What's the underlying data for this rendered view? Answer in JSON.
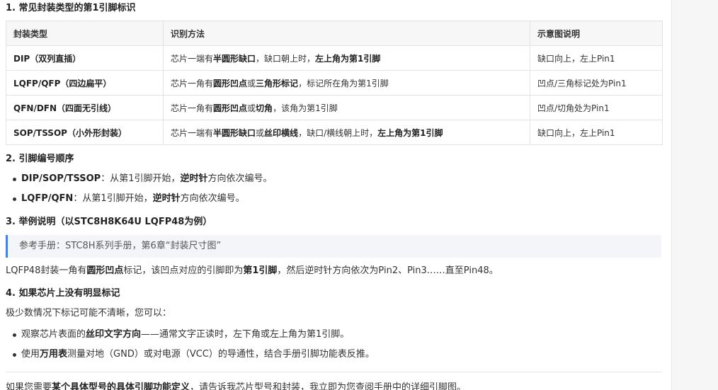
{
  "sec1": {
    "title": "1. 常见封装类型的第1引脚标识"
  },
  "table": {
    "headers": [
      "封装类型",
      "识别方法",
      "示意图说明"
    ],
    "rows": [
      {
        "type": "DIP（双列直插）",
        "m1": "芯片一端有",
        "m2": "半圆形缺口",
        "m3": "，缺口朝上时，",
        "m4": "左上角为第1引脚",
        "m5": "",
        "m6": "",
        "m7": "",
        "hint": "缺口向上，左上Pin1"
      },
      {
        "type": "LQFP/QFP（四边扁平）",
        "m1": "芯片一角有",
        "m2": "圆形凹点",
        "m3": "或",
        "m4": "三角形标记",
        "m5": "，标记所在角为第1引脚",
        "m6": "",
        "m7": "",
        "hint": "凹点/三角标记处为Pin1"
      },
      {
        "type": "QFN/DFN（四面无引线）",
        "m1": "芯片一角有",
        "m2": "圆形凹点",
        "m3": "或",
        "m4": "切角",
        "m5": "，该角为第1引脚",
        "m6": "",
        "m7": "",
        "hint": "凹点/切角处为Pin1"
      },
      {
        "type": "SOP/TSSOP（小外形封装）",
        "m1": "芯片一端有",
        "m2": "半圆形缺口",
        "m3": "或",
        "m4": "丝印横线",
        "m5": "，缺口/横线朝上时，",
        "m6": "左上角为第1引脚",
        "m7": "",
        "hint": "缺口向上，左上Pin1"
      }
    ]
  },
  "sec2": {
    "title": "2. 引脚编号顺序",
    "items": [
      {
        "a": "DIP/SOP/TSSOP",
        "b": "：从第1引脚开始，",
        "c": "逆时针",
        "d": "方向依次编号。"
      },
      {
        "a": "LQFP/QFN",
        "b": "：从第1引脚开始，",
        "c": "逆时针",
        "d": "方向依次编号。"
      }
    ]
  },
  "sec3": {
    "title": "3. 举例说明（以STC8H8K64U LQFP48为例）",
    "quote": "参考手册：STC8H系列手册，第6章“封装尺寸图”",
    "p1": "LQFP48封装一角有",
    "p2": "圆形凹点",
    "p3": "标记，该凹点对应的引脚即为",
    "p4": "第1引脚",
    "p5": "，然后逆时针方向依次为Pin2、Pin3……直至Pin48。"
  },
  "sec4": {
    "title": "4. 如果芯片上没有明显标记",
    "intro": "极少数情况下标记可能不清晰，您可以：",
    "items": [
      {
        "a": "观察芯片表面的",
        "b": "丝印文字方向",
        "c": "——通常文字正读时，左下角或左上角为第1引脚。"
      },
      {
        "a": "使用",
        "b": "万用表",
        "c": "测量对地（GND）或对电源（VCC）的导通性，结合手册引脚功能表反推。"
      }
    ]
  },
  "footer": {
    "p1": "如果您需要",
    "p2": "某个具体型号的具体引脚功能定义",
    "p3": "，请告诉我芯片型号和封装，我立即为您查阅手册中的详细引脚图。"
  }
}
